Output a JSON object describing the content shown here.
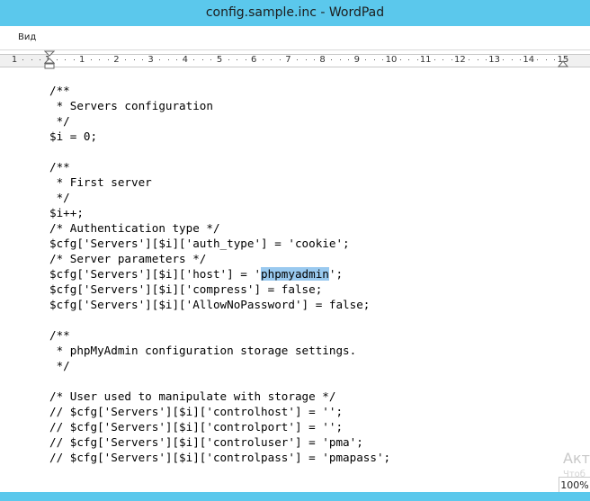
{
  "window": {
    "title": "config.sample.inc - WordPad"
  },
  "menu": {
    "items": [
      {
        "label": "Вид"
      }
    ]
  },
  "ruler": {
    "numbers": [
      "1",
      "1",
      "1",
      "2",
      "3",
      "4",
      "5",
      "6",
      "7",
      "8",
      "9",
      "10",
      "11",
      "12",
      "13",
      "14",
      "15"
    ]
  },
  "document": {
    "lines": [
      "/**",
      " * Servers configuration",
      " */",
      "$i = 0;",
      "",
      "/**",
      " * First server",
      " */",
      "$i++;",
      "/* Authentication type */",
      "$cfg['Servers'][$i]['auth_type'] = 'cookie';",
      "/* Server parameters */",
      "$cfg['Servers'][$i]['host'] = 'phpmyadmin';",
      "$cfg['Servers'][$i]['compress'] = false;",
      "$cfg['Servers'][$i]['AllowNoPassword'] = false;",
      "",
      "/**",
      " * phpMyAdmin configuration storage settings.",
      " */",
      "",
      "/* User used to manipulate with storage */",
      "// $cfg['Servers'][$i]['controlhost'] = '';",
      "// $cfg['Servers'][$i]['controlport'] = '';",
      "// $cfg['Servers'][$i]['controluser'] = 'pma';",
      "// $cfg['Servers'][$i]['controlpass'] = 'pmapass';"
    ],
    "selection": {
      "line": 12,
      "text": "phpmyadmin"
    }
  },
  "watermark": {
    "line1": "Акт",
    "line2": "Чтоб"
  },
  "status": {
    "zoom": "100%"
  },
  "colors": {
    "titlebar": "#5bc8ec",
    "selection": "#99c9ef"
  }
}
